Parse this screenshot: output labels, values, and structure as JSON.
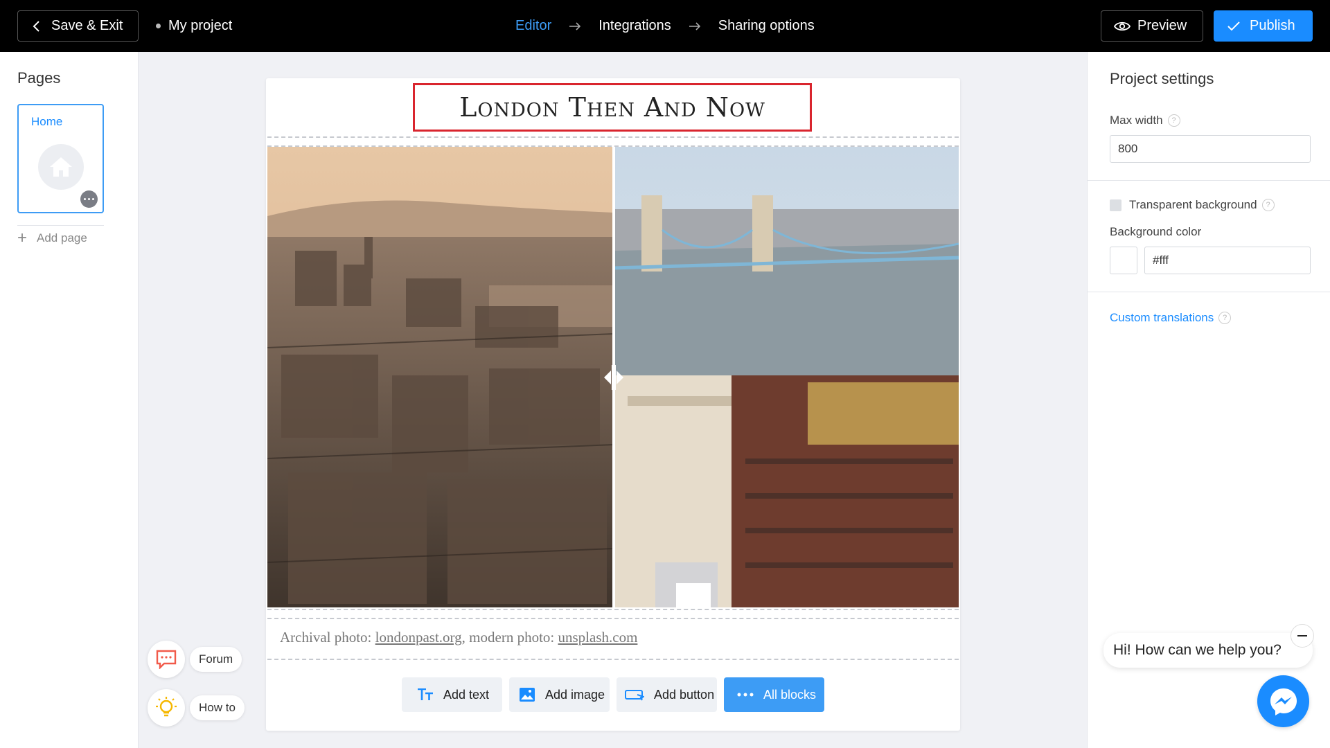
{
  "topbar": {
    "save_exit_label": "Save & Exit",
    "project_name": "My project",
    "steps": [
      "Editor",
      "Integrations",
      "Sharing options"
    ],
    "active_step": "Editor",
    "preview_label": "Preview",
    "publish_label": "Publish"
  },
  "sidebar": {
    "title": "Pages",
    "pages": [
      {
        "label": "Home",
        "selected": true
      }
    ],
    "add_page_label": "Add page"
  },
  "canvas": {
    "title": "London Then And Now",
    "caption_prefix": "Archival photo: ",
    "caption_link1": "londonpast.org",
    "caption_mid": ", modern photo: ",
    "caption_link2": "unsplash.com",
    "add_blocks": [
      "Add text",
      "Add image",
      "Add button",
      "All blocks"
    ]
  },
  "settings": {
    "title": "Project settings",
    "max_width_label": "Max width",
    "max_width_value": "800",
    "transparent_bg_label": "Transparent background",
    "transparent_bg_checked": false,
    "bg_color_label": "Background color",
    "bg_color_value": "#fff",
    "custom_translations_label": "Custom translations"
  },
  "help": {
    "forum_label": "Forum",
    "howto_label": "How to"
  },
  "chat": {
    "prompt": "Hi! How can we help you?"
  },
  "colors": {
    "accent": "#1a8cff",
    "title_border": "#d9252e",
    "topbar": "#000000"
  },
  "icons": [
    "chevron-left-icon",
    "eye-icon",
    "check-icon",
    "home-icon",
    "more-icon",
    "plus-icon",
    "text-icon",
    "image-icon",
    "button-icon",
    "dots-icon",
    "help-icon",
    "chat-icon",
    "lightbulb-icon",
    "messenger-icon",
    "minimize-icon",
    "split-handle-icon",
    "arrow-right-icon"
  ]
}
